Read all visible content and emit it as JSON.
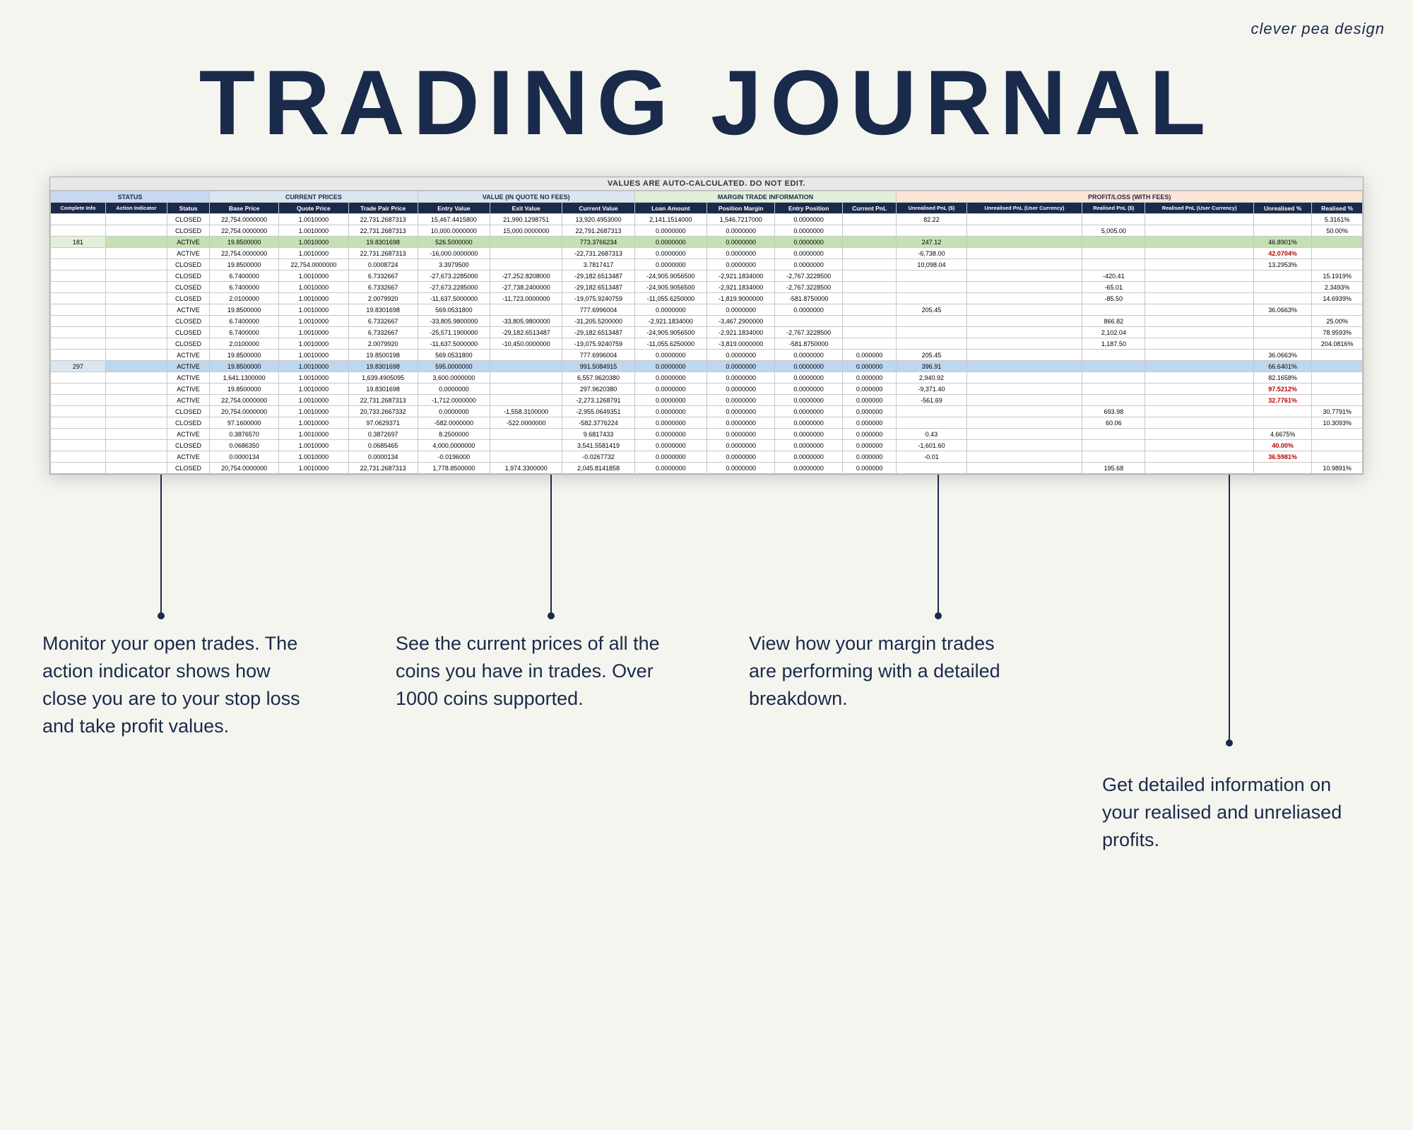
{
  "brand": {
    "name": "clever pea design"
  },
  "title": "TRADING JOURNAL",
  "spreadsheet": {
    "notice": "VALUES ARE AUTO-CALCULATED. DO NOT EDIT.",
    "header_groups": [
      {
        "label": "STATUS",
        "colspan": 3
      },
      {
        "label": "CURRENT PRICES",
        "colspan": 3
      },
      {
        "label": "VALUE (IN QUOTE NO FEES)",
        "colspan": 3
      },
      {
        "label": "MARGIN TRADE INFORMATION",
        "colspan": 4
      },
      {
        "label": "PROFIT/LOSS (WITH FEES)",
        "colspan": 6
      }
    ],
    "sub_headers": [
      "Complete Info",
      "Action Indicator",
      "Status",
      "Base Price",
      "Quote Price",
      "Trade Pair Price",
      "Entry Value",
      "Exit Value",
      "Current Value",
      "Loan Amount",
      "Position Margin",
      "Entry Position",
      "Current PnL",
      "Unrealised PnL ($)",
      "Unrealised PnL (User Currency)",
      "Realised PnL ($)",
      "Realised PnL (User Currency)",
      "Unrealised %",
      "Realised %"
    ],
    "rows": [
      {
        "complete": "",
        "indicator": "",
        "status": "CLOSED",
        "base": "22,754.0000000",
        "quote": "1.0010000",
        "pair": "22,731.2687313",
        "entry": "15,467.4415800",
        "exit": "21,990.1298751",
        "current": "13,920.4953000",
        "loan": "2,141.1514000",
        "pos_margin": "1,546.7217000",
        "entry_pos": "0.0000000",
        "current_pnl": "",
        "unreal_usd": "82.22",
        "unreal_user": "",
        "real_usd": "",
        "real_user": "",
        "unreal_pct": "",
        "real_pct": "5.3161%",
        "class": ""
      },
      {
        "complete": "",
        "indicator": "",
        "status": "CLOSED",
        "base": "22,754.0000000",
        "quote": "1.0010000",
        "pair": "22,731.2687313",
        "entry": "10,000.0000000",
        "exit": "15,000.0000000",
        "current": "22,791.2687313",
        "loan": "0.0000000",
        "pos_margin": "0.0000000",
        "entry_pos": "0.0000000",
        "current_pnl": "",
        "unreal_usd": "",
        "unreal_user": "",
        "real_usd": "5,005.00",
        "real_user": "",
        "unreal_pct": "",
        "real_pct": "50.00%",
        "class": ""
      },
      {
        "complete": "181",
        "indicator": "",
        "status": "ACTIVE",
        "base": "19.8500000",
        "quote": "1.0010000",
        "pair": "19.8301698",
        "entry": "526.5000000",
        "exit": "",
        "current": "773.3766234",
        "loan": "0.0000000",
        "pos_margin": "0.0000000",
        "entry_pos": "0.0000000",
        "current_pnl": "",
        "unreal_usd": "247.12",
        "unreal_user": "",
        "real_usd": "",
        "real_user": "",
        "unreal_pct": "46.8901%",
        "real_pct": "",
        "class": "row-181"
      },
      {
        "complete": "",
        "indicator": "",
        "status": "ACTIVE",
        "base": "22,754.0000000",
        "quote": "1.0010000",
        "pair": "22,731.2687313",
        "entry": "-16,000.0000000",
        "exit": "",
        "current": "-22,731.2687313",
        "loan": "0.0000000",
        "pos_margin": "0.0000000",
        "entry_pos": "0.0000000",
        "current_pnl": "",
        "unreal_usd": "-6,738.00",
        "unreal_user": "",
        "real_usd": "",
        "real_user": "",
        "unreal_pct": "42.0704%",
        "real_pct": "",
        "class": ""
      },
      {
        "complete": "",
        "indicator": "",
        "status": "CLOSED",
        "base": "19.8500000",
        "quote": "22,754.0000000",
        "pair": "0.0008724",
        "entry": "3.3979500",
        "exit": "",
        "current": "3.7817417",
        "loan": "0.0000000",
        "pos_margin": "0.0000000",
        "entry_pos": "0.0000000",
        "current_pnl": "",
        "unreal_usd": "10,098.04",
        "unreal_user": "",
        "real_usd": "",
        "real_user": "",
        "unreal_pct": "13.2953%",
        "real_pct": "",
        "class": ""
      },
      {
        "complete": "",
        "indicator": "",
        "status": "CLOSED",
        "base": "6.7400000",
        "quote": "1.0010000",
        "pair": "6.7332667",
        "entry": "-27,673.2285000",
        "exit": "-27,252.8208000",
        "current": "-29,182.6513487",
        "loan": "-24,905.9056500",
        "pos_margin": "-2,921.1834000",
        "entry_pos": "-2,767.3228500",
        "current_pnl": "",
        "unreal_usd": "",
        "unreal_user": "",
        "real_usd": "-420.41",
        "real_user": "",
        "unreal_pct": "",
        "real_pct": "15.1919%",
        "class": ""
      },
      {
        "complete": "",
        "indicator": "",
        "status": "CLOSED",
        "base": "6.7400000",
        "quote": "1.0010000",
        "pair": "6.7332667",
        "entry": "-27,673.2285000",
        "exit": "-27,738.2400000",
        "current": "-29,182.6513487",
        "loan": "-24,905.9056500",
        "pos_margin": "-2,921.1834000",
        "entry_pos": "-2,767.3228500",
        "current_pnl": "",
        "unreal_usd": "",
        "unreal_user": "",
        "real_usd": "-65.01",
        "real_user": "",
        "unreal_pct": "",
        "real_pct": "2.3493%",
        "class": ""
      },
      {
        "complete": "",
        "indicator": "",
        "status": "CLOSED",
        "base": "2.0100000",
        "quote": "1.0010000",
        "pair": "2.0079920",
        "entry": "-11,637.5000000",
        "exit": "-11,723.0000000",
        "current": "-19,075.9240759",
        "loan": "-11,055.6250000",
        "pos_margin": "-1,819.9000000",
        "entry_pos": "-581.8750000",
        "current_pnl": "",
        "unreal_usd": "",
        "unreal_user": "",
        "real_usd": "-85.50",
        "real_user": "",
        "unreal_pct": "",
        "real_pct": "14.6939%",
        "class": ""
      },
      {
        "complete": "",
        "indicator": "",
        "status": "ACTIVE",
        "base": "19.8500000",
        "quote": "1.0010000",
        "pair": "19.8301698",
        "entry": "569.0531800",
        "exit": "",
        "current": "777.6996004",
        "loan": "0.0000000",
        "pos_margin": "0.0000000",
        "entry_pos": "0.0000000",
        "current_pnl": "",
        "unreal_usd": "205.45",
        "unreal_user": "",
        "real_usd": "",
        "real_user": "",
        "unreal_pct": "36.0663%",
        "real_pct": "",
        "class": ""
      },
      {
        "complete": "",
        "indicator": "",
        "status": "CLOSED",
        "base": "6.7400000",
        "quote": "1.0010000",
        "pair": "6.7332667",
        "entry": "-33,805.9800000",
        "exit": "-33,805.9800000",
        "current": "-31,205.5200000",
        "loan": "-2,921.1834000",
        "pos_margin": "-3,467.2900000",
        "entry_pos": "",
        "current_pnl": "",
        "unreal_usd": "",
        "unreal_user": "",
        "real_usd": "866.82",
        "real_user": "",
        "unreal_pct": "",
        "real_pct": "25.00%",
        "class": ""
      },
      {
        "complete": "",
        "indicator": "",
        "status": "CLOSED",
        "base": "6.7400000",
        "quote": "1.0010000",
        "pair": "6.7332667",
        "entry": "-25,571.1900000",
        "exit": "-29,182.6513487",
        "current": "-29,182.6513487",
        "loan": "-24,905.9056500",
        "pos_margin": "-2,921.1834000",
        "entry_pos": "-2,767.3228500",
        "current_pnl": "",
        "unreal_usd": "",
        "unreal_user": "",
        "real_usd": "2,102.04",
        "real_user": "",
        "unreal_pct": "",
        "real_pct": "78.9593%",
        "class": ""
      },
      {
        "complete": "",
        "indicator": "",
        "status": "CLOSED",
        "base": "2.0100000",
        "quote": "1.0010000",
        "pair": "2.0079920",
        "entry": "-11,637.5000000",
        "exit": "-10,450.0000000",
        "current": "-19,075.9240759",
        "loan": "-11,055.6250000",
        "pos_margin": "-3,819.0000000",
        "entry_pos": "-581.8750000",
        "current_pnl": "",
        "unreal_usd": "",
        "unreal_user": "",
        "real_usd": "1,187.50",
        "real_user": "",
        "unreal_pct": "",
        "real_pct": "204.0816%",
        "class": ""
      },
      {
        "complete": "",
        "indicator": "",
        "status": "ACTIVE",
        "base": "19.8500000",
        "quote": "1.0010000",
        "pair": "19.8500198",
        "entry": "569.0531800",
        "exit": "",
        "current": "777.6996004",
        "loan": "0.0000000",
        "pos_margin": "0.0000000",
        "entry_pos": "0.0000000",
        "current_pnl": "0.000000",
        "unreal_usd": "205.45",
        "unreal_user": "",
        "real_usd": "",
        "real_user": "",
        "unreal_pct": "36.0663%",
        "real_pct": "",
        "class": ""
      },
      {
        "complete": "297",
        "indicator": "",
        "status": "ACTIVE",
        "base": "19.8500000",
        "quote": "1.0010000",
        "pair": "19.8301698",
        "entry": "595.0000000",
        "exit": "",
        "current": "991.5084915",
        "loan": "0.0000000",
        "pos_margin": "0.0000000",
        "entry_pos": "0.0000000",
        "current_pnl": "0.000000",
        "unreal_usd": "396.91",
        "unreal_user": "",
        "real_usd": "",
        "real_user": "",
        "unreal_pct": "66.6401%",
        "real_pct": "",
        "class": "row-297"
      },
      {
        "complete": "",
        "indicator": "",
        "status": "ACTIVE",
        "base": "1,641.1300000",
        "quote": "1.0010000",
        "pair": "1,639.4905095",
        "entry": "3,600.0000000",
        "exit": "",
        "current": "6,557.9620380",
        "loan": "0.0000000",
        "pos_margin": "0.0000000",
        "entry_pos": "0.0000000",
        "current_pnl": "0.000000",
        "unreal_usd": "2,940.92",
        "unreal_user": "",
        "real_usd": "",
        "real_user": "",
        "unreal_pct": "82.1658%",
        "real_pct": "",
        "class": ""
      },
      {
        "complete": "",
        "indicator": "",
        "status": "ACTIVE",
        "base": "19.8500000",
        "quote": "1.0010000",
        "pair": "19.8301698",
        "entry": "0.0000000",
        "exit": "",
        "current": "297.9620380",
        "loan": "0.0000000",
        "pos_margin": "0.0000000",
        "entry_pos": "0.0000000",
        "current_pnl": "0.000000",
        "unreal_usd": "-9,371.40",
        "unreal_user": "",
        "real_usd": "",
        "real_user": "",
        "unreal_pct": "97.5212%",
        "real_pct": "",
        "class": ""
      },
      {
        "complete": "",
        "indicator": "",
        "status": "ACTIVE",
        "base": "22,754.0000000",
        "quote": "1.0010000",
        "pair": "22,731.2687313",
        "entry": "-1,712.0000000",
        "exit": "",
        "current": "-2,273.1268791",
        "loan": "0.0000000",
        "pos_margin": "0.0000000",
        "entry_pos": "0.0000000",
        "current_pnl": "0.000000",
        "unreal_usd": "-561.69",
        "unreal_user": "",
        "real_usd": "",
        "real_user": "",
        "unreal_pct": "32.7761%",
        "real_pct": "",
        "class": ""
      },
      {
        "complete": "",
        "indicator": "",
        "status": "CLOSED",
        "base": "20,754.0000000",
        "quote": "1.0010000",
        "pair": "20,733.2667332",
        "entry": "0.0000000",
        "exit": "-1,558.3100000",
        "current": "-2,955.0649351",
        "loan": "0.0000000",
        "pos_margin": "0.0000000",
        "entry_pos": "0.0000000",
        "current_pnl": "0.000000",
        "unreal_usd": "",
        "unreal_user": "",
        "real_usd": "693.98",
        "real_user": "",
        "unreal_pct": "",
        "real_pct": "30.7791%",
        "class": ""
      },
      {
        "complete": "",
        "indicator": "",
        "status": "CLOSED",
        "base": "97.1600000",
        "quote": "1.0010000",
        "pair": "97.0629371",
        "entry": "-582.0000000",
        "exit": "-522.0000000",
        "current": "-582.3776224",
        "loan": "0.0000000",
        "pos_margin": "0.0000000",
        "entry_pos": "0.0000000",
        "current_pnl": "0.000000",
        "unreal_usd": "",
        "unreal_user": "",
        "real_usd": "60.06",
        "real_user": "",
        "unreal_pct": "",
        "real_pct": "10.3093%",
        "class": ""
      },
      {
        "complete": "",
        "indicator": "",
        "status": "ACTIVE",
        "base": "0.3876570",
        "quote": "1.0010000",
        "pair": "0.3872697",
        "entry": "8.2500000",
        "exit": "",
        "current": "9.6817433",
        "loan": "0.0000000",
        "pos_margin": "0.0000000",
        "entry_pos": "0.0000000",
        "current_pnl": "0.000000",
        "unreal_usd": "0.43",
        "unreal_user": "",
        "real_usd": "",
        "real_user": "",
        "unreal_pct": "4.6675%",
        "real_pct": "",
        "class": ""
      },
      {
        "complete": "",
        "indicator": "",
        "status": "CLOSED",
        "base": "0.0686350",
        "quote": "1.0010000",
        "pair": "0.0685465",
        "entry": "4,000.0000000",
        "exit": "",
        "current": "3,541.5581419",
        "loan": "0.0000000",
        "pos_margin": "0.0000000",
        "entry_pos": "0.0000000",
        "current_pnl": "0.000000",
        "unreal_usd": "-1,601.60",
        "unreal_user": "",
        "real_usd": "",
        "real_user": "",
        "unreal_pct": "40.00%",
        "real_pct": "",
        "class": ""
      },
      {
        "complete": "",
        "indicator": "",
        "status": "ACTIVE",
        "base": "0.0000134",
        "quote": "1.0010000",
        "pair": "0.0000134",
        "entry": "-0.0196000",
        "exit": "",
        "current": "-0.0267732",
        "loan": "0.0000000",
        "pos_margin": "0.0000000",
        "entry_pos": "0.0000000",
        "current_pnl": "0.000000",
        "unreal_usd": "-0.01",
        "unreal_user": "",
        "real_usd": "",
        "real_user": "",
        "unreal_pct": "36.5981%",
        "real_pct": "",
        "class": ""
      },
      {
        "complete": "",
        "indicator": "",
        "status": "CLOSED",
        "base": "20,754.0000000",
        "quote": "1.0010000",
        "pair": "22,731.2687313",
        "entry": "1,778.8500000",
        "exit": "1,974.3300000",
        "current": "2,045.8141858",
        "loan": "0.0000000",
        "pos_margin": "0.0000000",
        "entry_pos": "0.0000000",
        "current_pnl": "0.000000",
        "unreal_usd": "",
        "unreal_user": "",
        "real_usd": "195.68",
        "real_user": "",
        "unreal_pct": "",
        "real_pct": "10.9891%",
        "class": ""
      }
    ]
  },
  "annotations": {
    "left": {
      "title": "Monitor your open trades. The action indicator shows how close you are to your stop loss and take profit values."
    },
    "center": {
      "title": "See the current prices of all the coins you have in trades. Over 1000 coins supported."
    },
    "right_top": {
      "title": "View how your margin trades are performing with a detailed breakdown."
    },
    "right_bottom": {
      "title": "Get detailed information on your realised and unreliased profits."
    }
  }
}
